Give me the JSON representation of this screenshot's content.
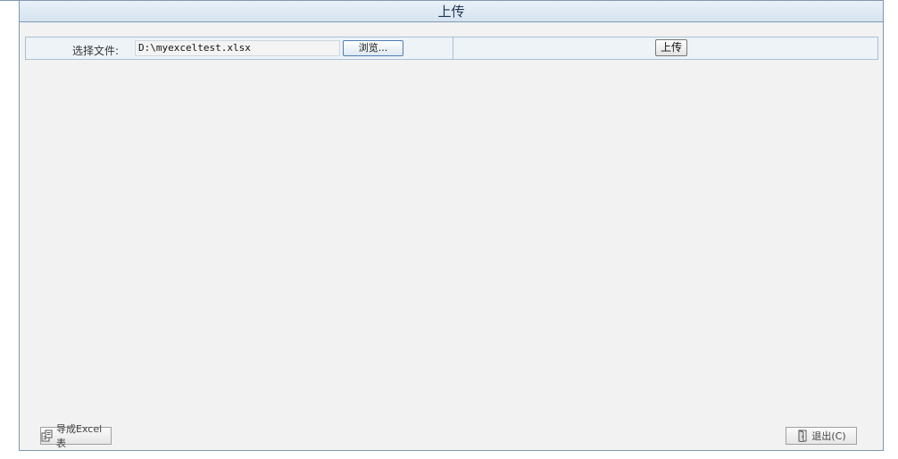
{
  "header": {
    "title": "上传"
  },
  "form": {
    "file_label": "选择文件:",
    "file_value": "D:\\myexceltest.xlsx",
    "browse_label": "浏览...",
    "upload_label": "上传"
  },
  "footer": {
    "export_label": "导成Excel表",
    "export_icon": "excel-export-icon",
    "exit_label": "退出(C)",
    "exit_icon": "door-exit-icon"
  },
  "colors": {
    "border": "#7f98b2",
    "title_bg": "#dce8f3",
    "content_bg": "#f2f2f2"
  }
}
